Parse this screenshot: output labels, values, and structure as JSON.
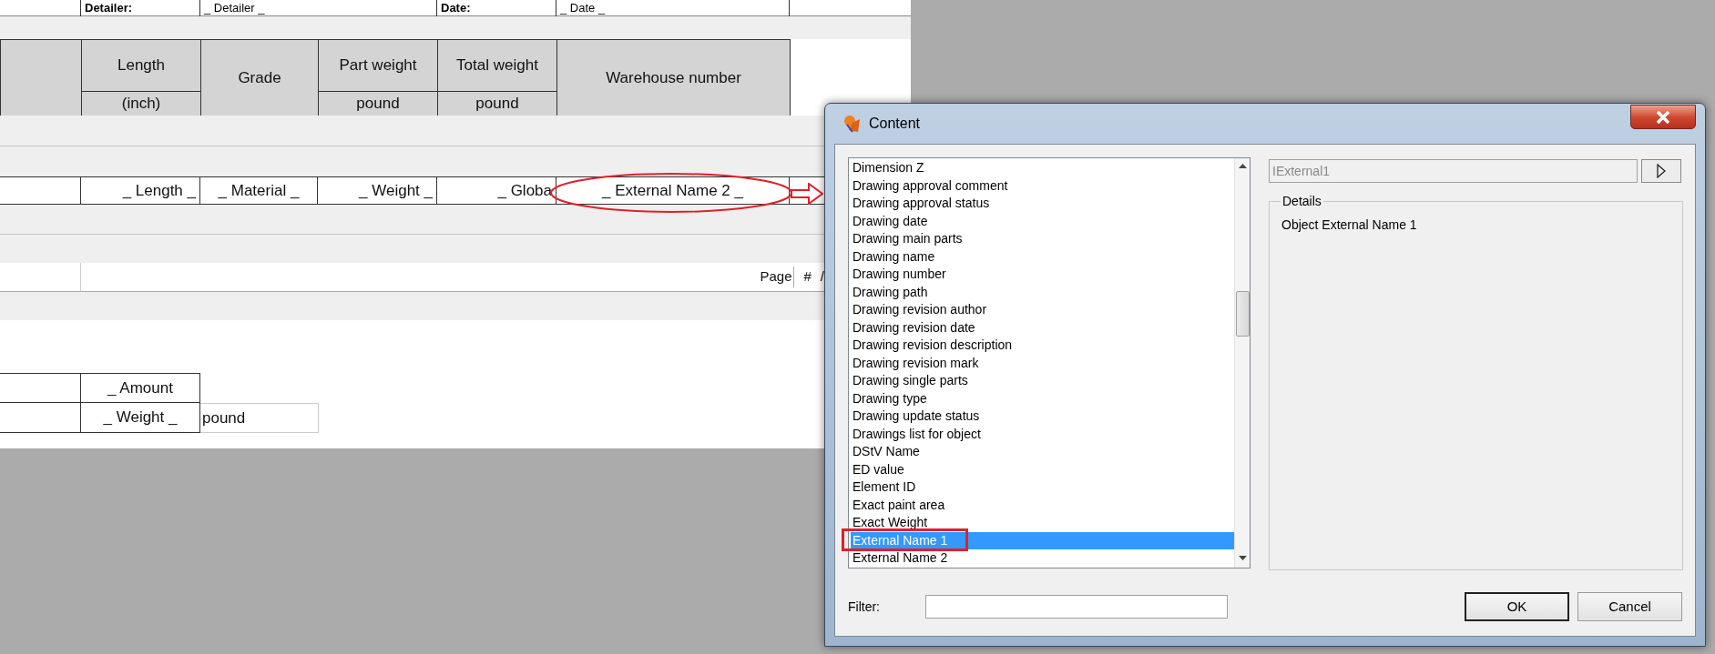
{
  "report": {
    "top_row": [
      {
        "text": "Detailer:",
        "kind": "label"
      },
      {
        "text": "_ Detailer _",
        "kind": "value"
      },
      {
        "text": "Date:",
        "kind": "label"
      },
      {
        "text": "_ Date _",
        "kind": "value"
      }
    ],
    "header": [
      {
        "label": "Length",
        "unit": "(inch)"
      },
      {
        "label": "Grade"
      },
      {
        "label": "Part weight",
        "unit": "pound"
      },
      {
        "label": "Total weight",
        "unit": "pound"
      },
      {
        "label": "Warehouse number"
      }
    ],
    "data_row": [
      "_ Length _",
      "_ Material _",
      "_ Weight _",
      "_ Globa",
      "_ External Name 2 _"
    ],
    "footer": [
      "Page",
      "#",
      "/"
    ],
    "summary": [
      {
        "value": "_ Amount"
      },
      {
        "value": "_ Weight _",
        "unit": "pound"
      }
    ]
  },
  "dialog": {
    "title": "Content",
    "items": [
      {
        "label": "Dimension Z",
        "selected": false
      },
      {
        "label": "Drawing approval comment",
        "selected": false
      },
      {
        "label": "Drawing approval status",
        "selected": false
      },
      {
        "label": "Drawing date",
        "selected": false
      },
      {
        "label": "Drawing main parts",
        "selected": false
      },
      {
        "label": "Drawing name",
        "selected": false
      },
      {
        "label": "Drawing number",
        "selected": false
      },
      {
        "label": "Drawing path",
        "selected": false
      },
      {
        "label": "Drawing revision author",
        "selected": false
      },
      {
        "label": "Drawing revision date",
        "selected": false
      },
      {
        "label": "Drawing revision description",
        "selected": false
      },
      {
        "label": "Drawing revision mark",
        "selected": false
      },
      {
        "label": "Drawing single parts",
        "selected": false
      },
      {
        "label": "Drawing type",
        "selected": false
      },
      {
        "label": "Drawing update status",
        "selected": false
      },
      {
        "label": "Drawings list for object",
        "selected": false
      },
      {
        "label": "DStV Name",
        "selected": false
      },
      {
        "label": "ED value",
        "selected": false
      },
      {
        "label": "Element ID",
        "selected": false
      },
      {
        "label": "Exact paint area",
        "selected": false
      },
      {
        "label": "Exact Weight",
        "selected": false
      },
      {
        "label": "External Name 1",
        "selected": true
      },
      {
        "label": "External Name 2",
        "selected": false
      }
    ],
    "value_field": {
      "value": "IExternal1",
      "disabled": true
    },
    "details_title": "Details",
    "details_text": "Object External Name 1",
    "filter_label": "Filter:",
    "buttons": [
      {
        "label": "OK",
        "default": true
      },
      {
        "label": "Cancel",
        "default": false
      }
    ]
  }
}
